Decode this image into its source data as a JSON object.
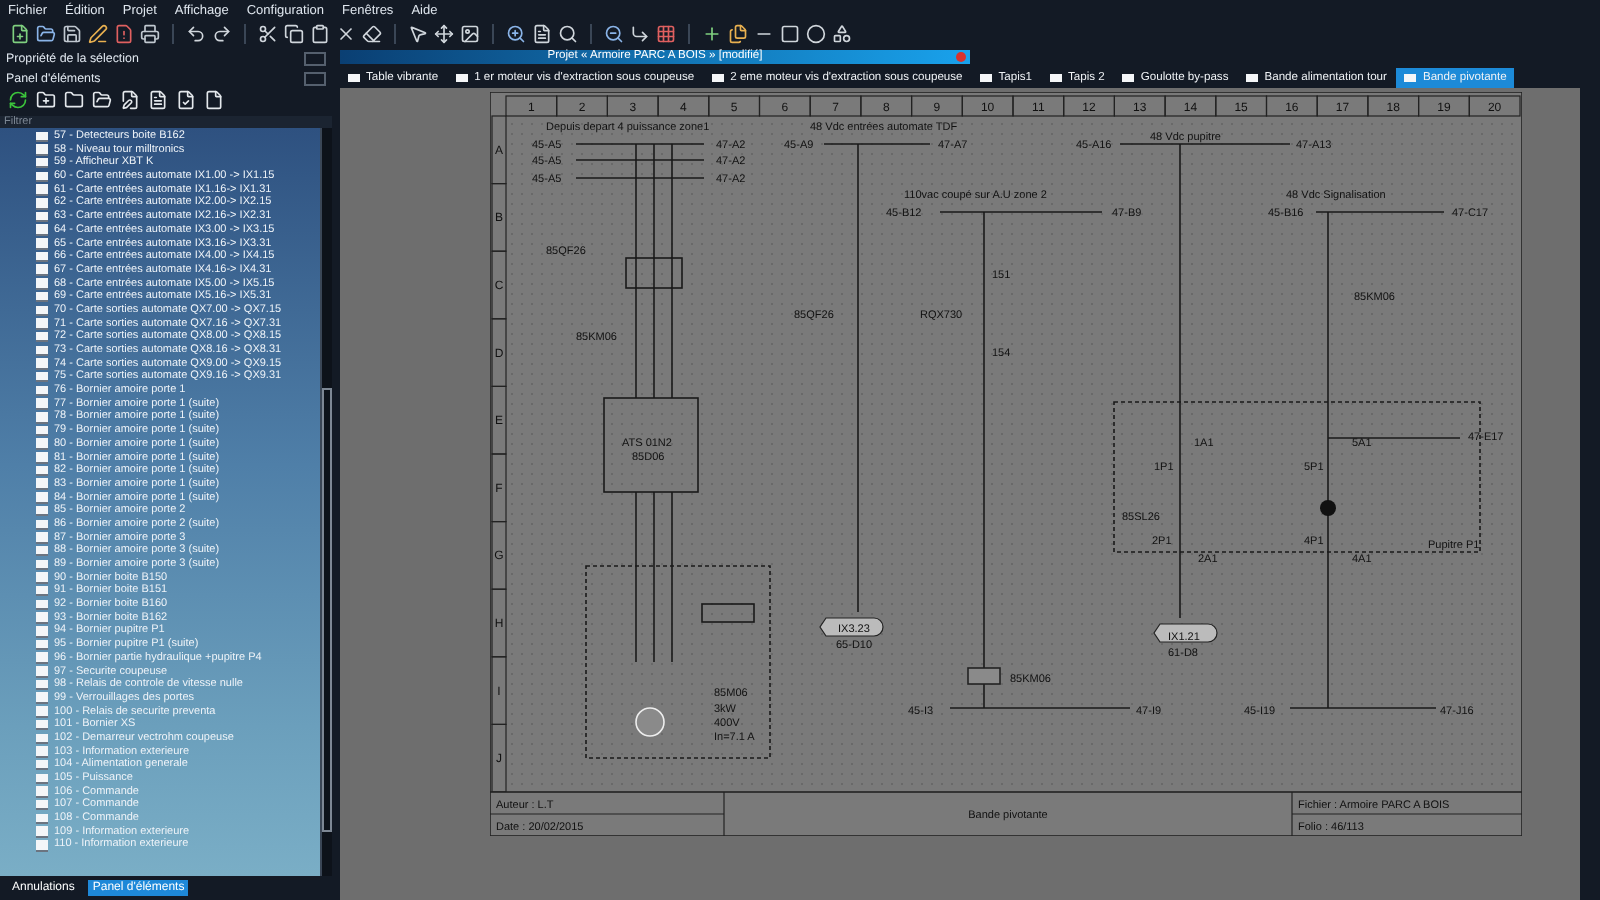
{
  "menu": [
    {
      "label": "Fichier"
    },
    {
      "label": "Édition"
    },
    {
      "label": "Projet"
    },
    {
      "label": "Affichage"
    },
    {
      "label": "Configuration"
    },
    {
      "label": "Fenêtres"
    },
    {
      "label": "Aide"
    }
  ],
  "dock_panels": [
    {
      "title": "Propriété de la sélection"
    },
    {
      "title": "Panel d'éléments"
    }
  ],
  "filter": {
    "placeholder": "Filtrer"
  },
  "element_list": [
    {
      "label": "57 - Detecteurs boite B162"
    },
    {
      "label": "58 - Niveau tour milltronics"
    },
    {
      "label": "59 - Afficheur XBT K"
    },
    {
      "label": "60 - Carte entrées automate IX1.00 -> IX1.15"
    },
    {
      "label": "61 - Carte entrées automate IX1.16-> IX1.31"
    },
    {
      "label": "62 - Carte entrées automate IX2.00-> IX2.15"
    },
    {
      "label": "63 - Carte entrées automate IX2.16-> IX2.31"
    },
    {
      "label": "64 - Carte entrées automate IX3.00 -> IX3.15"
    },
    {
      "label": "65 - Carte entrées automate IX3.16-> IX3.31"
    },
    {
      "label": "66 - Carte entrées automate IX4.00 -> IX4.15"
    },
    {
      "label": "67 - Carte entrées automate IX4.16-> IX4.31"
    },
    {
      "label": "68 - Carte entrées automate IX5.00 -> IX5.15"
    },
    {
      "label": "69 - Carte entrées automate IX5.16-> IX5.31"
    },
    {
      "label": "70 - Carte sorties automate QX7.00 -> QX7.15"
    },
    {
      "label": "71 - Carte sorties automate QX7.16 -> QX7.31"
    },
    {
      "label": "72 - Carte sorties automate QX8.00 -> QX8.15"
    },
    {
      "label": "73 - Carte sorties automate QX8.16 -> QX8.31"
    },
    {
      "label": "74 - Carte sorties automate QX9.00 -> QX9.15"
    },
    {
      "label": "75 - Carte sorties automate QX9.16 -> QX9.31"
    },
    {
      "label": "76 - Bornier amoire porte 1"
    },
    {
      "label": "77 - Bornier amoire porte 1 (suite)"
    },
    {
      "label": "78 - Bornier amoire porte 1 (suite)"
    },
    {
      "label": "79 - Bornier amoire porte 1 (suite)"
    },
    {
      "label": "80 - Bornier amoire porte 1 (suite)"
    },
    {
      "label": "81 - Bornier amoire porte 1 (suite)"
    },
    {
      "label": "82 - Bornier amoire porte 1 (suite)"
    },
    {
      "label": "83 - Bornier amoire porte 1 (suite)"
    },
    {
      "label": "84 - Bornier amoire porte 1 (suite)"
    },
    {
      "label": "85 - Bornier amoire porte 2"
    },
    {
      "label": "86 - Bornier amoire porte 2 (suite)"
    },
    {
      "label": "87 - Bornier amoire porte 3"
    },
    {
      "label": "88 - Bornier amoire porte 3 (suite)"
    },
    {
      "label": "89 - Bornier amoire porte 3 (suite)"
    },
    {
      "label": "90 - Bornier boite B150"
    },
    {
      "label": "91 - Bornier boite B151"
    },
    {
      "label": "92 - Bornier boite B160"
    },
    {
      "label": "93 - Bornier boite B162"
    },
    {
      "label": "94 - Bornier pupitre P1"
    },
    {
      "label": "95 - Bornier pupitre P1 (suite)"
    },
    {
      "label": "96 - Bornier  partie hydraulique +pupitre P4"
    },
    {
      "label": "97 - Securite coupeuse"
    },
    {
      "label": "98 - Relais de controle de vitesse nulle"
    },
    {
      "label": "99 - Verrouillages des portes"
    },
    {
      "label": "100 - Relais de securite preventa"
    },
    {
      "label": "101 - Bornier XS"
    },
    {
      "label": "102 - Demarreur vectrohm coupeuse"
    },
    {
      "label": "103 - Information exterieure"
    },
    {
      "label": "104 - Alimentation generale"
    },
    {
      "label": "105 - Puissance"
    },
    {
      "label": "106 - Commande"
    },
    {
      "label": "107 - Commande"
    },
    {
      "label": "108 - Commande"
    },
    {
      "label": "109 - Information exterieure"
    },
    {
      "label": "110 - Information exterieure"
    }
  ],
  "bottom_tabs": [
    {
      "label": "Annulations",
      "selected": false
    },
    {
      "label": "Panel d'éléments",
      "selected": true
    }
  ],
  "project_window": {
    "title": "Projet « Armoire PARC A BOIS » [modifié]"
  },
  "folio_tabs": [
    {
      "label": "Table vibrante",
      "selected": false
    },
    {
      "label": "1 er moteur vis d'extraction sous coupeuse",
      "selected": false
    },
    {
      "label": "2 eme moteur vis d'extraction sous coupeuse",
      "selected": false
    },
    {
      "label": "Tapis1",
      "selected": false
    },
    {
      "label": "Tapis 2",
      "selected": false
    },
    {
      "label": "Goulotte by-pass",
      "selected": false
    },
    {
      "label": "Bande alimentation tour",
      "selected": false
    },
    {
      "label": "Bande pivotante",
      "selected": true
    }
  ],
  "schematic": {
    "columns": [
      "1",
      "2",
      "3",
      "4",
      "5",
      "6",
      "7",
      "8",
      "9",
      "10",
      "11",
      "12",
      "13",
      "14",
      "15",
      "16",
      "17",
      "18",
      "19",
      "20"
    ],
    "rows": [
      "A",
      "B",
      "C",
      "D",
      "E",
      "F",
      "G",
      "H",
      "I",
      "J"
    ],
    "labels": [
      {
        "text": "Depuis depart 4 puissance zone1"
      },
      {
        "text": "45-A5"
      },
      {
        "text": "45-A5"
      },
      {
        "text": "45-A5"
      },
      {
        "text": "47-A2"
      },
      {
        "text": "47-A2"
      },
      {
        "text": "47-A2"
      },
      {
        "text": "48 Vdc entrées automate TDF"
      },
      {
        "text": "45-A9"
      },
      {
        "text": "47-A7"
      },
      {
        "text": "110vac coupé sur A.U zone 2"
      },
      {
        "text": "45-B12"
      },
      {
        "text": "47-B9"
      },
      {
        "text": "48 Vdc pupitre"
      },
      {
        "text": "45-A16"
      },
      {
        "text": "47-A13"
      },
      {
        "text": "48 Vdc Signalisation"
      },
      {
        "text": "45-B16"
      },
      {
        "text": "47-C17"
      },
      {
        "text": "85QF26"
      },
      {
        "text": "85KM06"
      },
      {
        "text": "ATS 01N2"
      },
      {
        "text": "85D06"
      },
      {
        "text": "85QF26"
      },
      {
        "text": "RQX730"
      },
      {
        "text": "151"
      },
      {
        "text": "154"
      },
      {
        "text": "85KM06"
      },
      {
        "text": "1A1"
      },
      {
        "text": "5A1"
      },
      {
        "text": "1P1"
      },
      {
        "text": "5P1"
      },
      {
        "text": "85SL26"
      },
      {
        "text": "2P1"
      },
      {
        "text": "2A1"
      },
      {
        "text": "4P1"
      },
      {
        "text": "4A1"
      },
      {
        "text": "Pupitre P1"
      },
      {
        "text": "47-E17"
      },
      {
        "text": "IX3.23"
      },
      {
        "text": "65-D10"
      },
      {
        "text": "IX1.21"
      },
      {
        "text": "61-D8"
      },
      {
        "text": "85KM06"
      },
      {
        "text": "85M06"
      },
      {
        "text": "3kW"
      },
      {
        "text": "400V"
      },
      {
        "text": "In=7.1 A"
      },
      {
        "text": "45-I3"
      },
      {
        "text": "47-I9"
      },
      {
        "text": "45-I19"
      },
      {
        "text": "47-J16"
      }
    ],
    "title_block": {
      "author": "Auteur : L.T",
      "date": "Date : 20/02/2015",
      "title": "Bande pivotante",
      "file": "Fichier : Armoire PARC A BOIS",
      "folio": "Folio : 46/113"
    }
  }
}
